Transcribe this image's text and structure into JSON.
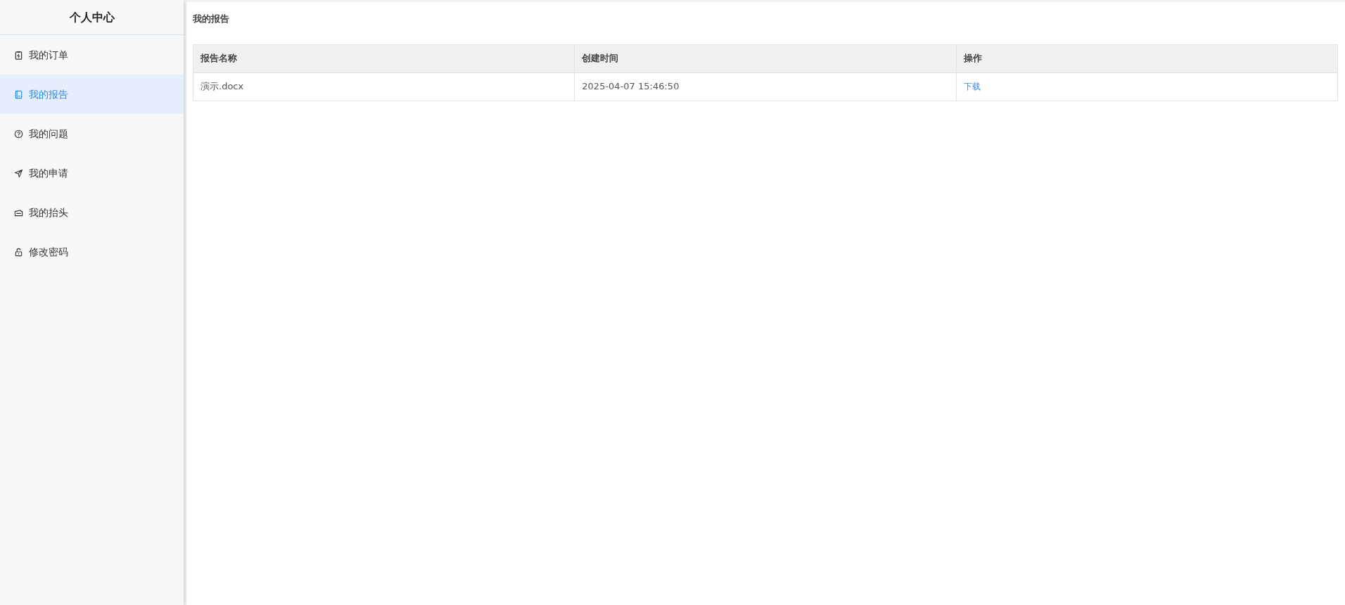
{
  "sidebar": {
    "title": "个人中心",
    "items": [
      {
        "label": "我的订单",
        "selected": false
      },
      {
        "label": "我的报告",
        "selected": true
      },
      {
        "label": "我的问题",
        "selected": false
      },
      {
        "label": "我的申请",
        "selected": false
      },
      {
        "label": "我的抬头",
        "selected": false
      },
      {
        "label": "修改密码",
        "selected": false
      }
    ]
  },
  "main": {
    "title": "我的报告",
    "table": {
      "columns": [
        "报告名称",
        "创建时间",
        "操作"
      ],
      "rows": [
        {
          "name": "演示.docx",
          "created": "2025-04-07 15:46:50",
          "action": "下载"
        }
      ]
    }
  }
}
